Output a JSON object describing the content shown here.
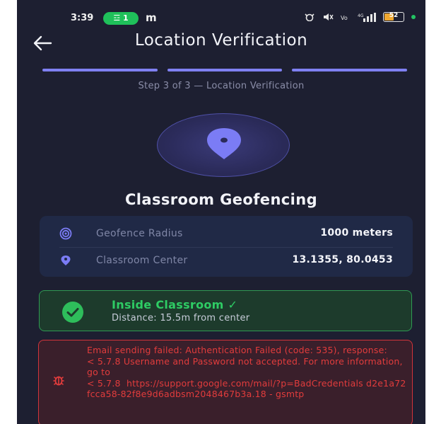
{
  "status_bar": {
    "time": "3:39",
    "pill_text": "☲ 1",
    "carrier_glyph": "m",
    "battery_level": "52",
    "network_text": "⁹⁴ᴳ ᴳ"
  },
  "header": {
    "title": "Location Verification",
    "back_icon": "arrow-left-icon"
  },
  "progress": {
    "steps_total": 3,
    "steps_done": 3,
    "label": "Step 3 of 3 — Location Verification"
  },
  "section_title": "Classroom Geofencing",
  "info": {
    "radius_label": "Geofence Radius",
    "radius_value": "1000 meters",
    "center_label": "Classroom Center",
    "center_value": "13.1355, 80.0453"
  },
  "status": {
    "title": "Inside Classroom ✓",
    "subtitle": "Distance: 15.5m from center"
  },
  "error": {
    "message": "Email sending failed: Authentication Failed (code: 535), response:\n< 5.7.8 Username and Password not accepted. For more information, go to\n< 5.7.8  https://support.google.com/mail/?p=BadCredentials d2e1a72fcca58-82f8e9d6adbsm2048467b3a.18 - gsmtp"
  },
  "colors": {
    "background": "#1d1f31",
    "accent": "#7f80f2",
    "success": "#2ecc64",
    "error": "#e23c3c"
  }
}
